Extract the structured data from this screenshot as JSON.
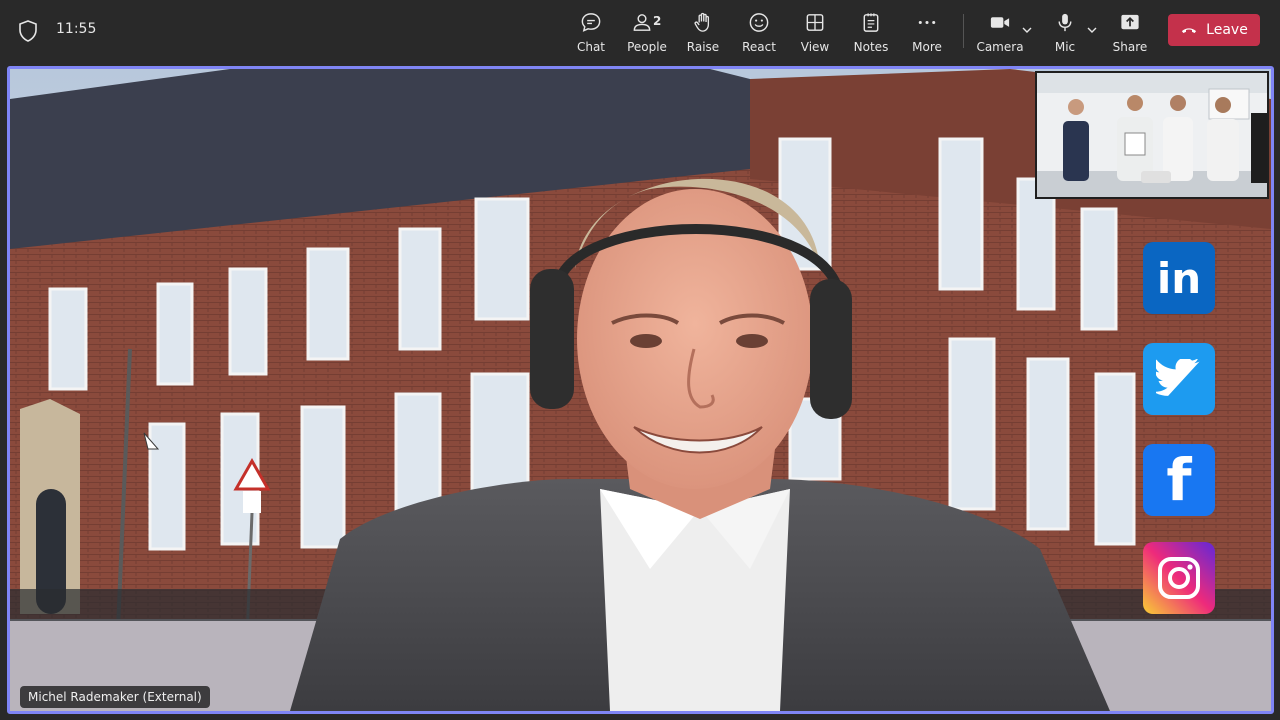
{
  "status": {
    "time": "11:55"
  },
  "toolbar": {
    "chat": "Chat",
    "people": "People",
    "people_count": "2",
    "raise": "Raise",
    "react": "React",
    "view": "View",
    "notes": "Notes",
    "more": "More",
    "camera": "Camera",
    "mic": "Mic",
    "share": "Share",
    "leave": "Leave"
  },
  "video": {
    "participant_name": "Michel Rademaker (External)",
    "social_icons": [
      "linkedin-icon",
      "twitter-icon",
      "facebook-icon",
      "instagram-icon"
    ],
    "linkedin_text": "in",
    "facebook_text": "f"
  },
  "colors": {
    "accent_border": "#7f85f5",
    "leave_red": "#c4314b",
    "toolbar_bg": "#292929"
  }
}
